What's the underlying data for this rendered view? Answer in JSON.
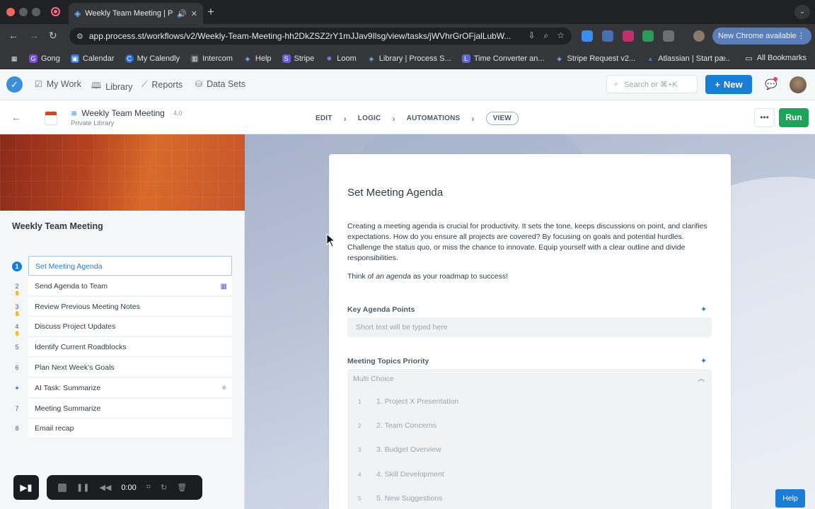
{
  "browser": {
    "tab_title": "Weekly Team Meeting | Pr",
    "url": "app.process.st/workflows/v2/Weekly-Team-Meeting-hh2DkZSZ2rY1mJJav9Ilsg/view/tasks/jWVhrGrOFjalLubW...",
    "new_chrome": "New Chrome available",
    "bookmarks": [
      "Gong",
      "Calendar",
      "My Calendly",
      "Intercom",
      "Help",
      "Stripe",
      "Loom",
      "Library | Process S...",
      "Time Converter an...",
      "Stripe Request v2...",
      "Atlassian | Start pa..."
    ],
    "all_bookmarks": "All Bookmarks"
  },
  "appnav": {
    "my_work": "My Work",
    "library": "Library",
    "reports": "Reports",
    "data_sets": "Data Sets",
    "search_placeholder": "Search or ⌘+K",
    "new_label": "New"
  },
  "workflow": {
    "title": "Weekly Team Meeting",
    "version": "4.0",
    "subtitle": "Private Library",
    "steps": [
      "EDIT",
      "LOGIC",
      "AUTOMATIONS",
      "VIEW"
    ],
    "run_label": "Run"
  },
  "sidebar": {
    "title": "Weekly Team Meeting",
    "tasks": [
      {
        "num": "1",
        "label": "Set Meeting Agenda"
      },
      {
        "num": "2",
        "label": "Send Agenda to Team"
      },
      {
        "num": "3",
        "label": "Review Previous Meeting Notes"
      },
      {
        "num": "4",
        "label": "Discuss Project Updates"
      },
      {
        "num": "5",
        "label": "Identify Current Roadblocks"
      },
      {
        "num": "6",
        "label": "Plan Next Week's Goals"
      },
      {
        "num": "",
        "label": "AI Task: Summarize"
      },
      {
        "num": "7",
        "label": "Meeting Summarize"
      },
      {
        "num": "8",
        "label": "Email recap"
      }
    ]
  },
  "recorder": {
    "time": "0:00"
  },
  "task": {
    "title": "Set Meeting Agenda",
    "description": "Creating a meeting agenda is crucial for productivity. It sets the tone, keeps discussions on point, and clarifies expectations. How do you ensure all projects are covered? By focusing on goals and potential hurdles. Challenge the status quo, or miss the chance to innovate. Equip yourself with a clear outline and divide responsibilities.",
    "tagline_pre": "Think of ",
    "tagline_em": "an agenda",
    "tagline_post": " as your roadmap to success!",
    "field1_label": "Key Agenda Points",
    "field1_placeholder": "Short text will be typed here",
    "field2_label": "Meeting Topics Priority",
    "field2_placeholder": "Multi Choice",
    "options": [
      {
        "n": "1",
        "label": "1. Project X Presentation"
      },
      {
        "n": "2",
        "label": "2. Team Concerns"
      },
      {
        "n": "3",
        "label": "3. Budget Overview"
      },
      {
        "n": "4",
        "label": "4. Skill Development"
      },
      {
        "n": "5",
        "label": "5. New Suggestions"
      }
    ]
  },
  "help_label": "Help"
}
